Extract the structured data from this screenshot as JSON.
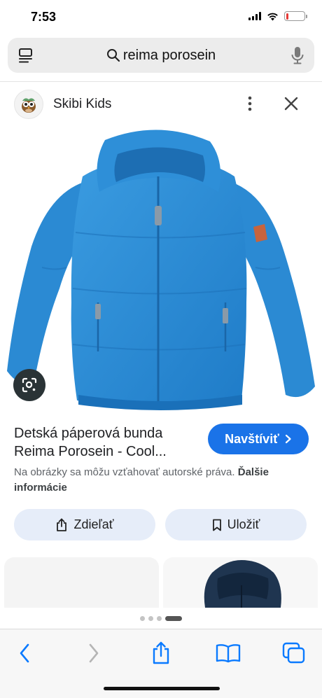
{
  "status_bar": {
    "time": "7:53",
    "battery_level": 0.12,
    "battery_color": "#e53935"
  },
  "search": {
    "query": "reima porosein",
    "icons": [
      "tab-menu-icon",
      "search-icon",
      "microphone-icon"
    ]
  },
  "source": {
    "name": "Skibi Kids",
    "favicon": "owl-logo-icon"
  },
  "result": {
    "title_line1": "Detská páperová bunda",
    "title_line2": "Reima Porosein - Cool...",
    "visit_label": "Navštíviť",
    "copyright_text": "Na obrázky sa môžu vzťahovať autorské práva.",
    "copyright_link": "Ďalšie informácie",
    "image_subject": "blue-hooded-down-jacket",
    "image_color": "#2f8fd6"
  },
  "actions": {
    "share_label": "Zdieľať",
    "save_label": "Uložiť"
  },
  "carousel": {
    "dot_count": 4,
    "active_index": 3
  },
  "colors": {
    "accent": "#1a73e8",
    "action_bg": "#e6edf9",
    "safari_blue": "#0a7aff"
  }
}
